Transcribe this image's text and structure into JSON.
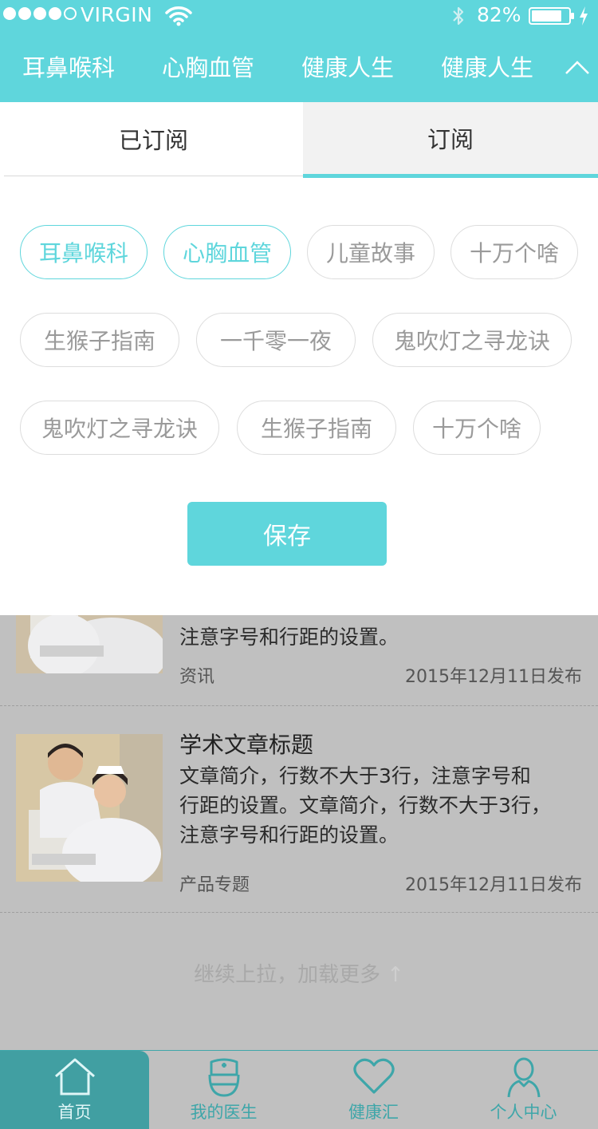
{
  "status_bar": {
    "carrier": "VIRGIN",
    "battery": "82%",
    "battery_level": 0.82
  },
  "nav": {
    "tabs": [
      "耳鼻喉科",
      "心胸血管",
      "健康人生",
      "健康人生"
    ]
  },
  "panel": {
    "segments": {
      "subscribed": "已订阅",
      "subscribe": "订阅"
    },
    "chips": [
      {
        "label": "耳鼻喉科",
        "active": true
      },
      {
        "label": "心胸血管",
        "active": true
      },
      {
        "label": "儿童故事",
        "active": false
      },
      {
        "label": "十万个啥",
        "active": false
      },
      {
        "label": "生猴子指南",
        "active": false
      },
      {
        "label": "一千零一夜",
        "active": false
      },
      {
        "label": "鬼吹灯之寻龙诀",
        "active": false
      },
      {
        "label": "鬼吹灯之寻龙诀",
        "active": false
      },
      {
        "label": "生猴子指南",
        "active": false
      },
      {
        "label": "十万个啥",
        "active": false
      }
    ],
    "save_label": "保存"
  },
  "articles": [
    {
      "summary_tail": "注意字号和行距的设置。",
      "category": "资讯",
      "date": "2015年12月11日发布"
    },
    {
      "title": "学术文章标题",
      "summary_lines": [
        "文章简介，行数不大于3行，注意字号和",
        "行距的设置。文章简介，行数不大于3行，",
        "注意字号和行距的设置。"
      ],
      "category": "产品专题",
      "date": "2015年12月11日发布"
    }
  ],
  "load_more": "继续上拉，加载更多",
  "tabbar": {
    "items": [
      {
        "label": "首页",
        "icon": "home-icon",
        "active": true
      },
      {
        "label": "我的医生",
        "icon": "nurse-icon",
        "active": false
      },
      {
        "label": "健康汇",
        "icon": "heart-icon",
        "active": false
      },
      {
        "label": "个人中心",
        "icon": "person-icon",
        "active": false
      }
    ]
  },
  "colors": {
    "accent": "#5fd6dc",
    "tab_active": "#419fa2",
    "overlay_gray": "#c0c0c0"
  }
}
